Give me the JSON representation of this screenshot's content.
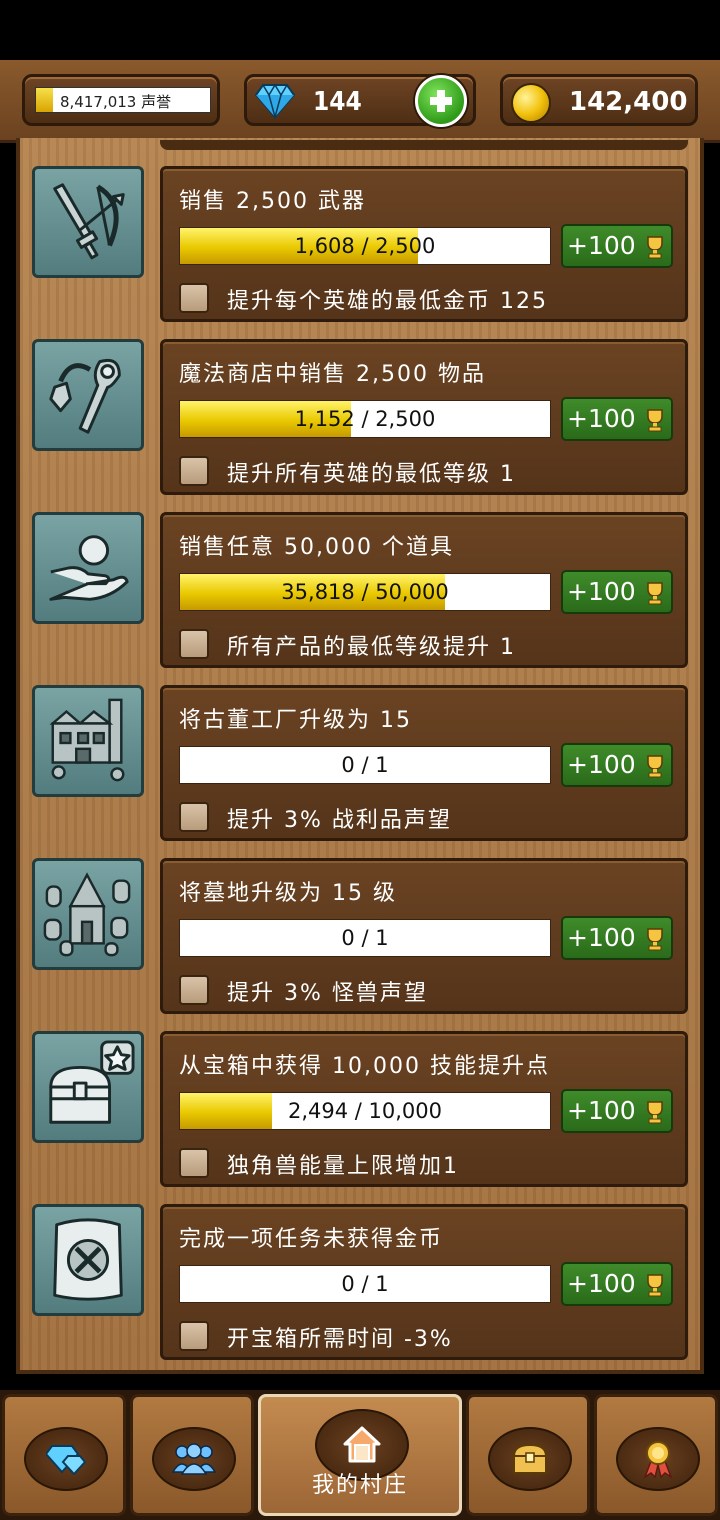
{
  "resources": {
    "reputation_text": "8,417,013 声誉",
    "reputation_fill": 0.1,
    "gems": "144",
    "gold": "142,400"
  },
  "tasks": [
    {
      "icon": "weapons-icon",
      "title": "销售 2,500 武器",
      "progress_text": "1,608 / 2,500",
      "progress": 0.643,
      "reward": "+100",
      "bonus": "提升每个英雄的最低金币 125"
    },
    {
      "icon": "magic-items-icon",
      "title": "魔法商店中销售 2,500 物品",
      "progress_text": "1,152 / 2,500",
      "progress": 0.461,
      "reward": "+100",
      "bonus": "提升所有英雄的最低等级 1"
    },
    {
      "icon": "hand-offer-icon",
      "title": "销售任意 50,000 个道具",
      "progress_text": "35,818 / 50,000",
      "progress": 0.716,
      "reward": "+100",
      "bonus": "所有产品的最低等级提升 1"
    },
    {
      "icon": "factory-icon",
      "title": "将古董工厂升级为 15",
      "progress_text": "0 / 1",
      "progress": 0,
      "reward": "+100",
      "bonus": "提升 3% 战利品声望"
    },
    {
      "icon": "graveyard-icon",
      "title": "将墓地升级为 15 级",
      "progress_text": "0 / 1",
      "progress": 0,
      "reward": "+100",
      "bonus": "提升 3% 怪兽声望"
    },
    {
      "icon": "chest-star-icon",
      "title": "从宝箱中获得 10,000 技能提升点",
      "progress_text": "2,494 / 10,000",
      "progress": 0.249,
      "reward": "+100",
      "bonus": "独角兽能量上限增加1"
    },
    {
      "icon": "map-x-icon",
      "title": "完成一项任务未获得金币",
      "progress_text": "0 / 1",
      "progress": 0,
      "reward": "+100",
      "bonus": "开宝箱所需时间 -3%"
    }
  ],
  "nav": {
    "active_label": "我的村庄",
    "items": [
      "gems-icon",
      "heroes-icon",
      "village-home-icon",
      "chest-icon",
      "achievements-medal-icon"
    ]
  },
  "colors": {
    "wood": "#a2703e",
    "card": "#55341a",
    "progress_fill": "#e9c800",
    "reward_green": "#2a6b1a"
  }
}
